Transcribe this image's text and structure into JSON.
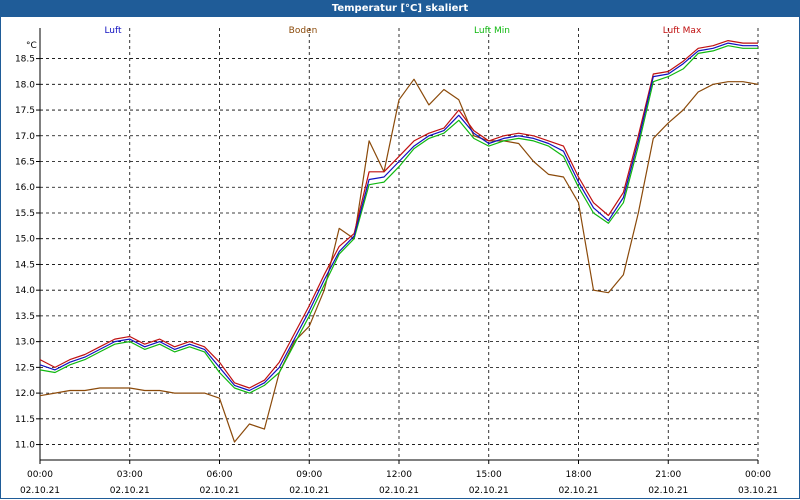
{
  "header": {
    "title": "Temperatur [°C] skaliert"
  },
  "chart_data": {
    "type": "line",
    "title": "Temperatur [°C] skaliert",
    "ylabel": "°C",
    "xlabel": "",
    "ylim": [
      10.7,
      18.9
    ],
    "y_ticks": [
      11.0,
      11.5,
      12.0,
      12.5,
      13.0,
      13.5,
      14.0,
      14.5,
      15.0,
      15.5,
      16.0,
      16.5,
      17.0,
      17.5,
      18.0,
      18.5
    ],
    "x_ticks": [
      {
        "time": "00:00",
        "date": "02.10.21"
      },
      {
        "time": "03:00",
        "date": "02.10.21"
      },
      {
        "time": "06:00",
        "date": "02.10.21"
      },
      {
        "time": "09:00",
        "date": "02.10.21"
      },
      {
        "time": "12:00",
        "date": "02.10.21"
      },
      {
        "time": "15:00",
        "date": "02.10.21"
      },
      {
        "time": "18:00",
        "date": "02.10.21"
      },
      {
        "time": "21:00",
        "date": "02.10.21"
      },
      {
        "time": "00:00",
        "date": "03.10.21"
      }
    ],
    "grid": true,
    "legend_position": "top",
    "x_hours": [
      0,
      0.5,
      1,
      1.5,
      2,
      2.5,
      3,
      3.5,
      4,
      4.5,
      5,
      5.5,
      6,
      6.5,
      7,
      7.5,
      8,
      8.5,
      9,
      9.5,
      10,
      10.5,
      11,
      11.5,
      12,
      12.5,
      13,
      13.5,
      14,
      14.5,
      15,
      15.5,
      16,
      16.5,
      17,
      17.5,
      18,
      18.5,
      19,
      19.5,
      20,
      20.5,
      21,
      21.5,
      22,
      22.5,
      23,
      23.5,
      24
    ],
    "series": [
      {
        "name": "Luft",
        "color": "#1010c0",
        "values": [
          12.55,
          12.45,
          12.6,
          12.7,
          12.85,
          13.0,
          13.05,
          12.9,
          13.0,
          12.85,
          12.95,
          12.85,
          12.5,
          12.15,
          12.05,
          12.2,
          12.5,
          13.05,
          13.6,
          14.2,
          14.75,
          15.05,
          16.15,
          16.2,
          16.5,
          16.8,
          17.0,
          17.1,
          17.4,
          17.05,
          16.85,
          16.95,
          17.0,
          16.95,
          16.85,
          16.7,
          16.1,
          15.6,
          15.35,
          15.8,
          16.9,
          18.15,
          18.2,
          18.4,
          18.65,
          18.7,
          18.8,
          18.75,
          18.75
        ]
      },
      {
        "name": "Boden",
        "color": "#8b4a0a",
        "values": [
          11.95,
          12.0,
          12.05,
          12.05,
          12.1,
          12.1,
          12.1,
          12.05,
          12.05,
          12.0,
          12.0,
          12.0,
          11.9,
          11.05,
          11.4,
          11.3,
          12.4,
          13.0,
          13.3,
          14.0,
          15.2,
          15.0,
          16.9,
          16.3,
          17.7,
          18.1,
          17.6,
          17.9,
          17.7,
          17.0,
          16.9,
          16.9,
          16.85,
          16.5,
          16.25,
          16.2,
          15.7,
          14.0,
          13.95,
          14.3,
          15.5,
          16.95,
          17.25,
          17.5,
          17.85,
          18.0,
          18.05,
          18.05,
          18.0
        ]
      },
      {
        "name": "Luft Min",
        "color": "#10b810",
        "values": [
          12.45,
          12.4,
          12.55,
          12.65,
          12.8,
          12.95,
          13.0,
          12.85,
          12.95,
          12.8,
          12.9,
          12.8,
          12.4,
          12.1,
          12.0,
          12.15,
          12.4,
          12.95,
          13.5,
          14.1,
          14.7,
          15.0,
          16.05,
          16.1,
          16.4,
          16.75,
          16.95,
          17.05,
          17.3,
          16.95,
          16.8,
          16.9,
          16.95,
          16.9,
          16.8,
          16.6,
          16.0,
          15.5,
          15.3,
          15.7,
          16.8,
          18.05,
          18.15,
          18.3,
          18.6,
          18.65,
          18.75,
          18.7,
          18.7
        ]
      },
      {
        "name": "Luft Max",
        "color": "#c01010",
        "values": [
          12.65,
          12.5,
          12.65,
          12.75,
          12.9,
          13.05,
          13.1,
          12.95,
          13.05,
          12.9,
          13.0,
          12.9,
          12.6,
          12.2,
          12.1,
          12.25,
          12.6,
          13.15,
          13.7,
          14.3,
          14.85,
          15.1,
          16.3,
          16.3,
          16.6,
          16.9,
          17.05,
          17.15,
          17.5,
          17.1,
          16.9,
          17.0,
          17.05,
          17.0,
          16.9,
          16.8,
          16.2,
          15.7,
          15.45,
          15.9,
          17.0,
          18.2,
          18.25,
          18.45,
          18.7,
          18.75,
          18.85,
          18.8,
          18.8
        ]
      }
    ]
  }
}
